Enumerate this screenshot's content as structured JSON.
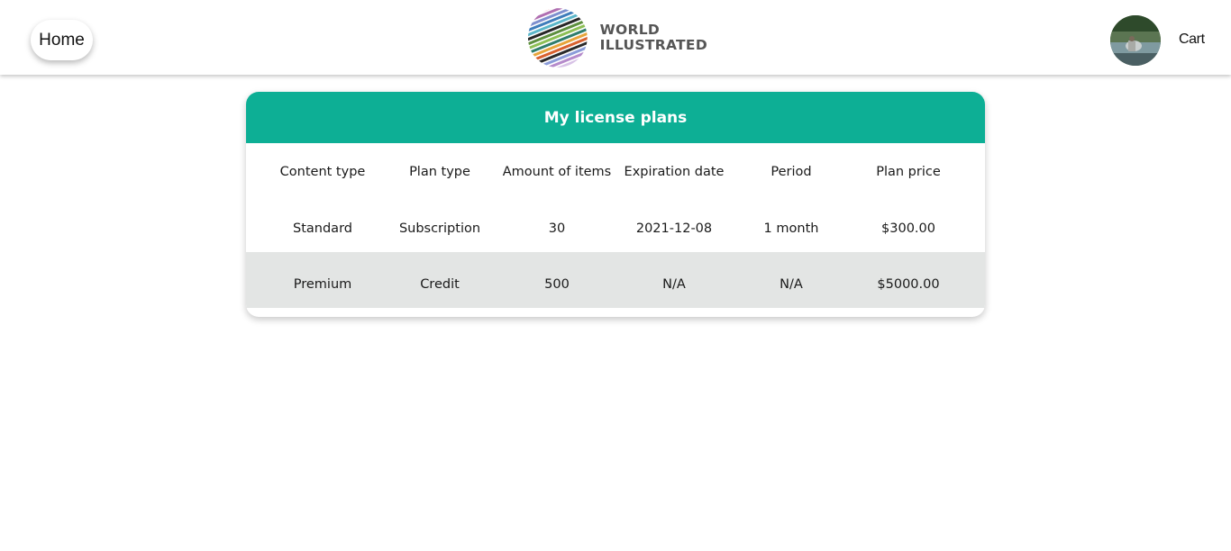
{
  "nav": {
    "home_label": "Home",
    "logo_line1": "WORLD",
    "logo_line2": "ILLUSTRATED",
    "cart_label": "Cart"
  },
  "colors": {
    "accent": "#0daf95",
    "row_highlight": "#e3e5e4"
  },
  "plans": {
    "title": "My license plans",
    "columns": [
      "Content type",
      "Plan type",
      "Amount of items",
      "Expiration date",
      "Period",
      "Plan price"
    ],
    "rows": [
      [
        "Standard",
        "Subscription",
        "30",
        "2021-12-08",
        "1 month",
        "$300.00"
      ],
      [
        "Premium",
        "Credit",
        "500",
        "N/A",
        "N/A",
        "$5000.00"
      ]
    ]
  }
}
